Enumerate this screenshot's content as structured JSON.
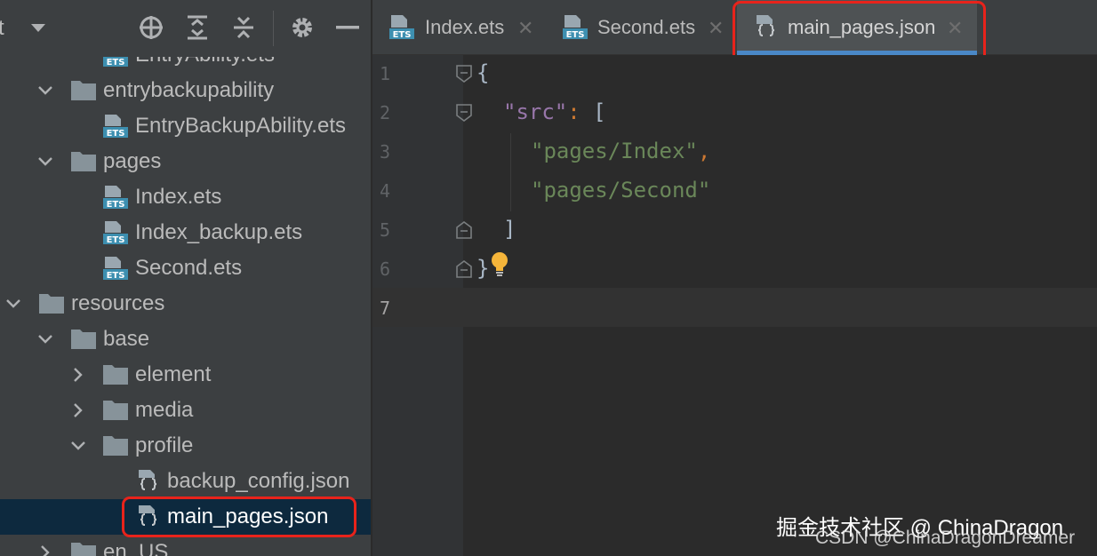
{
  "toolbar": {
    "truncated_label": "t",
    "icons": [
      "dropdown-arrow-icon",
      "locate-icon",
      "expand-all-icon",
      "collapse-all-icon",
      "gear-icon",
      "minimize-icon"
    ]
  },
  "tree": [
    {
      "label": "EntryAbility.ets",
      "type": "ets",
      "indent": 2,
      "state": "none"
    },
    {
      "label": "entrybackupability",
      "type": "folder",
      "indent": 1,
      "state": "expanded"
    },
    {
      "label": "EntryBackupAbility.ets",
      "type": "ets",
      "indent": 2,
      "state": "none"
    },
    {
      "label": "pages",
      "type": "folder",
      "indent": 1,
      "state": "expanded"
    },
    {
      "label": "Index.ets",
      "type": "ets",
      "indent": 2,
      "state": "none"
    },
    {
      "label": "Index_backup.ets",
      "type": "ets",
      "indent": 2,
      "state": "none"
    },
    {
      "label": "Second.ets",
      "type": "ets",
      "indent": 2,
      "state": "none"
    },
    {
      "label": "resources",
      "type": "folder",
      "indent": 0,
      "state": "expanded"
    },
    {
      "label": "base",
      "type": "folder",
      "indent": 1,
      "state": "expanded"
    },
    {
      "label": "element",
      "type": "folder",
      "indent": 2,
      "state": "collapsed"
    },
    {
      "label": "media",
      "type": "folder",
      "indent": 2,
      "state": "collapsed"
    },
    {
      "label": "profile",
      "type": "folder",
      "indent": 2,
      "state": "expanded"
    },
    {
      "label": "backup_config.json",
      "type": "json",
      "indent": 3,
      "state": "none"
    },
    {
      "label": "main_pages.json",
      "type": "json",
      "indent": 3,
      "state": "none",
      "selected": true
    },
    {
      "label": "en_US",
      "type": "folder",
      "indent": 1,
      "state": "collapsed"
    }
  ],
  "tabs": [
    {
      "label": "Index.ets",
      "type": "ets",
      "active": false
    },
    {
      "label": "Second.ets",
      "type": "ets",
      "active": false
    },
    {
      "label": "main_pages.json",
      "type": "json",
      "active": true
    }
  ],
  "tab_close_glyph": "✕",
  "editor": {
    "line_numbers": [
      "1",
      "2",
      "3",
      "4",
      "5",
      "6",
      "7"
    ],
    "current_line": "7",
    "code": {
      "l1_brace": "{",
      "l2_key": "\"src\"",
      "l2_colon": ":",
      "l2_bracket": "[",
      "l3_str": "\"pages/Index\"",
      "l3_comma": ",",
      "l4_str": "\"pages/Second\"",
      "l5_bracket": "]",
      "l6_brace": "}"
    }
  },
  "watermark": {
    "line1": "掘金技术社区 @ ChinaDragon",
    "line2": "CSDN @ChinaDragonDreamer"
  },
  "colors": {
    "highlight": "#e8231b",
    "selection": "#0d293e",
    "tab_underline": "#4a88c7",
    "json_key": "#9876aa",
    "json_string": "#6a8759",
    "bulb": "#f5b53a"
  }
}
